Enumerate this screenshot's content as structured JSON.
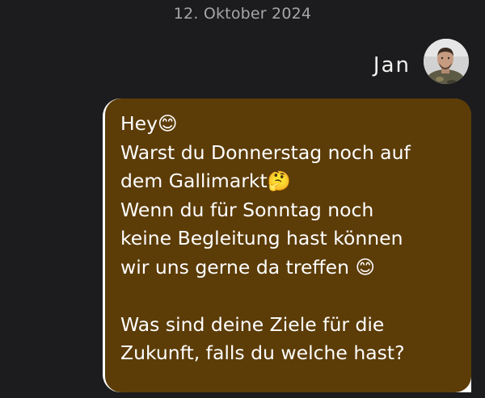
{
  "conversation": {
    "date_label": "12. Oktober 2024",
    "sender_name": "Jan",
    "avatar_icon": "user-avatar-photo",
    "bubble_color": "#5c3c07",
    "message_lines": [
      "Hey😊",
      "Warst du Donnerstag noch auf",
      "dem Gallimarkt🤔",
      "Wenn du für Sonntag noch",
      "keine Begleitung hast können",
      "wir uns gerne da treffen 😊",
      "",
      "Was sind deine Ziele für die",
      "Zukunft, falls du welche hast?"
    ]
  }
}
